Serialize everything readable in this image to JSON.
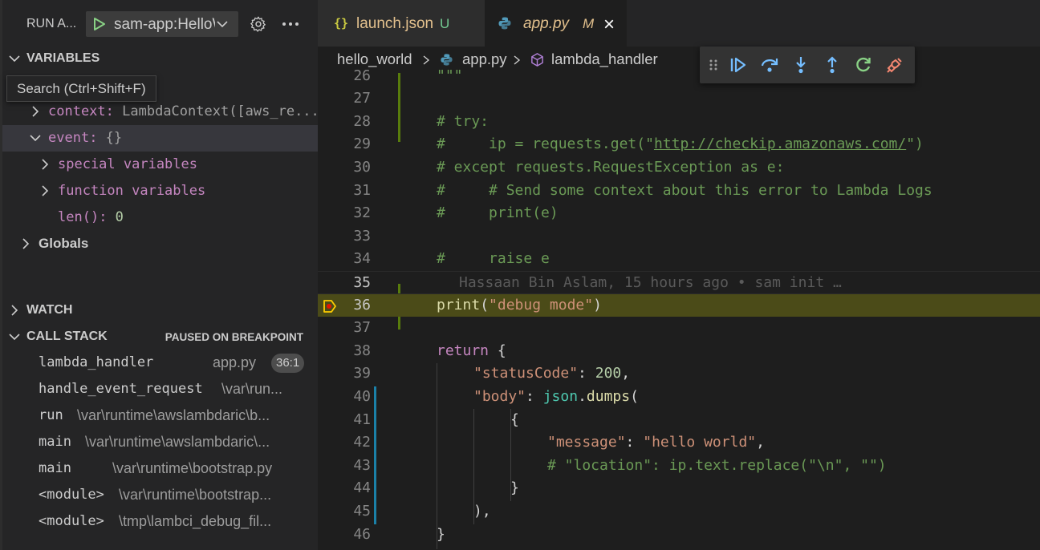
{
  "colors": {
    "sidebar_bg": "#252526",
    "editor_bg": "#1e1e1e",
    "breakpoint_line": "#4b4b18",
    "accent_green": "#89d185",
    "debug_blue": "#75beff"
  },
  "sidebar": {
    "run_title": "RUN A...",
    "config": {
      "label": "sam-app:HelloWorldFunction",
      "play_icon": "play-icon",
      "dropdown_icon": "chevron-down-icon"
    },
    "gear_icon": "gear-icon",
    "more_icon": "ellipsis-icon",
    "variables": {
      "title": "VARIABLES",
      "tooltip": "Search (Ctrl+Shift+F)",
      "rows": [
        {
          "name": "context",
          "sep": ": ",
          "value": "LambdaContext([aws_re..."
        },
        {
          "name": "event",
          "sep": ": ",
          "value": "{}"
        },
        {
          "name": "special variables"
        },
        {
          "name": "function variables"
        },
        {
          "name": "len()",
          "sep": ": ",
          "value": "0"
        }
      ],
      "globals": "Globals"
    },
    "watch": {
      "title": "WATCH"
    },
    "call_stack": {
      "title": "CALL STACK",
      "status": "PAUSED ON BREAKPOINT",
      "frames": [
        {
          "fn": "lambda_handler",
          "file": "app.py",
          "line": "36:1"
        },
        {
          "fn": "handle_event_request",
          "file": "\\var\\run..."
        },
        {
          "fn": "run",
          "file": "\\var\\runtime\\awslambdaric\\b..."
        },
        {
          "fn": "main",
          "file": "\\var\\runtime\\awslambdaric\\..."
        },
        {
          "fn": "main",
          "file": "\\var\\runtime\\bootstrap.py"
        },
        {
          "fn": "<module>",
          "file": "\\var\\runtime\\bootstrap..."
        },
        {
          "fn": "<module>",
          "file": "\\tmp\\lambci_debug_fil..."
        }
      ]
    }
  },
  "editor": {
    "tabs": [
      {
        "name": "launch.json",
        "badge": "U",
        "icon": "json-icon"
      },
      {
        "name": "app.py",
        "badge": "M",
        "icon": "python-icon",
        "close": "×"
      }
    ],
    "breadcrumb": {
      "folder": "hello_world",
      "file": "app.py",
      "symbol": "lambda_handler"
    },
    "debug_toolbar": [
      "drag-handle-icon",
      "continue-icon",
      "step-over-icon",
      "step-into-icon",
      "step-out-icon",
      "restart-icon",
      "disconnect-icon"
    ],
    "lines": {
      "n26": "26",
      "t26": "\"\"\"",
      "n27": "27",
      "n28": "28",
      "t28": "# try:",
      "n29": "29",
      "t29a": "#     ip = requests.get(\"",
      "t29b": "http://checkip.amazonaws.com/",
      "t29c": "\")",
      "n30": "30",
      "t30": "# except requests.RequestException as e:",
      "n31": "31",
      "t31": "#     # Send some context about this error to Lambda Logs",
      "n32": "32",
      "t32": "#     print(e)",
      "n33": "33",
      "n34": "34",
      "t34": "#     raise e",
      "n35": "35",
      "t35": "Hassaan Bin Aslam, 15 hours ago • sam init …",
      "n36": "36",
      "t36a": "print",
      "t36b": "(",
      "t36c": "\"debug mode\"",
      "t36d": ")",
      "n37": "37",
      "n38": "38",
      "t38a": "return",
      "t38b": " {",
      "n39": "39",
      "t39a": "\"statusCode\"",
      "t39b": ": ",
      "t39c": "200",
      "t39d": ",",
      "n40": "40",
      "t40a": "\"body\"",
      "t40b": ": ",
      "t40c": "json",
      "t40d": ".",
      "t40e": "dumps",
      "t40f": "(",
      "n41": "41",
      "t41": "{",
      "n42": "42",
      "t42a": "\"message\"",
      "t42b": ": ",
      "t42c": "\"hello world\"",
      "t42d": ",",
      "n43": "43",
      "t43": "# \"location\": ip.text.replace(\"\\n\", \"\")",
      "n44": "44",
      "t44": "}",
      "n45": "45",
      "t45": "),",
      "n46": "46",
      "t46": "}"
    }
  }
}
